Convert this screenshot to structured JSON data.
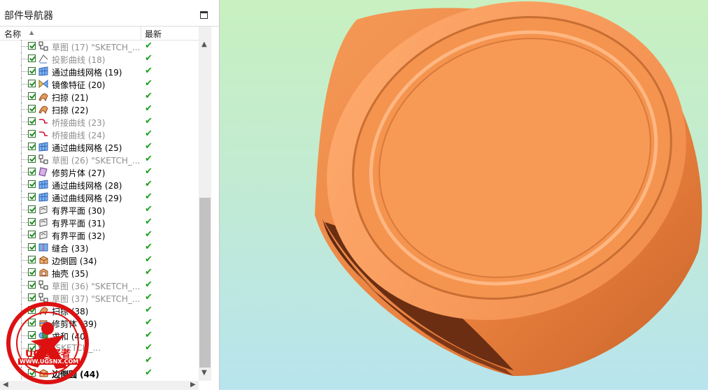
{
  "navigator": {
    "title": "部件导航器",
    "columns": {
      "name": "名称",
      "latest": "最新"
    },
    "items": [
      {
        "label": "草图 (17) \"SKETCH_...",
        "icon": "sketch-icon",
        "dim": true
      },
      {
        "label": "投影曲线 (18)",
        "icon": "projected-curve-icon",
        "dim": true
      },
      {
        "label": "通过曲线网格 (19)",
        "icon": "curve-mesh-icon",
        "dim": false
      },
      {
        "label": "镜像特征 (20)",
        "icon": "mirror-feature-icon",
        "dim": false
      },
      {
        "label": "扫掠 (21)",
        "icon": "swept-icon",
        "dim": false
      },
      {
        "label": "扫掠 (22)",
        "icon": "swept-icon",
        "dim": false
      },
      {
        "label": "桥接曲线 (23)",
        "icon": "bridge-curve-icon",
        "dim": true
      },
      {
        "label": "桥接曲线 (24)",
        "icon": "bridge-curve-icon",
        "dim": true
      },
      {
        "label": "通过曲线网格 (25)",
        "icon": "curve-mesh-icon",
        "dim": false
      },
      {
        "label": "草图 (26) \"SKETCH_...",
        "icon": "sketch-icon",
        "dim": true
      },
      {
        "label": "修剪片体 (27)",
        "icon": "trim-sheet-icon",
        "dim": false
      },
      {
        "label": "通过曲线网格 (28)",
        "icon": "curve-mesh-icon",
        "dim": false
      },
      {
        "label": "通过曲线网格 (29)",
        "icon": "curve-mesh-icon",
        "dim": false
      },
      {
        "label": "有界平面 (30)",
        "icon": "bounded-plane-icon",
        "dim": false
      },
      {
        "label": "有界平面 (31)",
        "icon": "bounded-plane-icon",
        "dim": false
      },
      {
        "label": "有界平面 (32)",
        "icon": "bounded-plane-icon",
        "dim": false
      },
      {
        "label": "缝合 (33)",
        "icon": "sew-icon",
        "dim": false
      },
      {
        "label": "边倒圆 (34)",
        "icon": "edge-blend-icon",
        "dim": false
      },
      {
        "label": "抽壳 (35)",
        "icon": "shell-icon",
        "dim": false
      },
      {
        "label": "草图 (36) \"SKETCH_...",
        "icon": "sketch-icon",
        "dim": true
      },
      {
        "label": "草图 (37) \"SKETCH_...",
        "icon": "sketch-icon",
        "dim": true
      },
      {
        "label": "扫掠 (38)",
        "icon": "swept-icon",
        "dim": false
      },
      {
        "label": "修剪体 (39)",
        "icon": "trim-body-icon",
        "dim": false
      },
      {
        "label": "求和 (40)",
        "icon": "unite-icon",
        "dim": false
      },
      {
        "label": "\"SKETCH_...",
        "icon": "sketch-icon",
        "dim": true
      },
      {
        "label": "",
        "icon": "",
        "dim": false
      },
      {
        "label": "边倒圆 (44)",
        "icon": "edge-blend-icon",
        "dim": false,
        "bold": true
      }
    ]
  },
  "watermark": {
    "text": "UG爱好者",
    "url": "WWW.UGSNX.COM"
  },
  "colors": {
    "model": "#f0904e",
    "model_dark": "#8a3c14",
    "check": "#1ca01c"
  }
}
